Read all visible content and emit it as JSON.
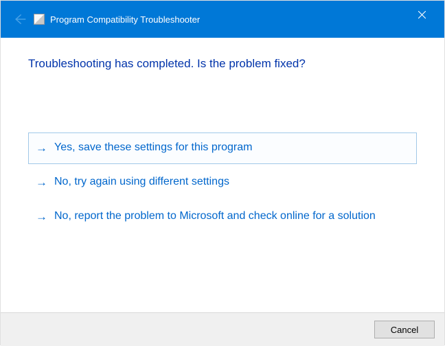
{
  "titlebar": {
    "title": "Program Compatibility Troubleshooter"
  },
  "main": {
    "heading": "Troubleshooting has completed.  Is the problem fixed?",
    "options": {
      "yes_save": "Yes, save these settings for this program",
      "no_retry": "No, try again using different settings",
      "no_report": "No, report the problem to Microsoft and check online for a solution"
    }
  },
  "footer": {
    "cancel_label": "Cancel"
  }
}
